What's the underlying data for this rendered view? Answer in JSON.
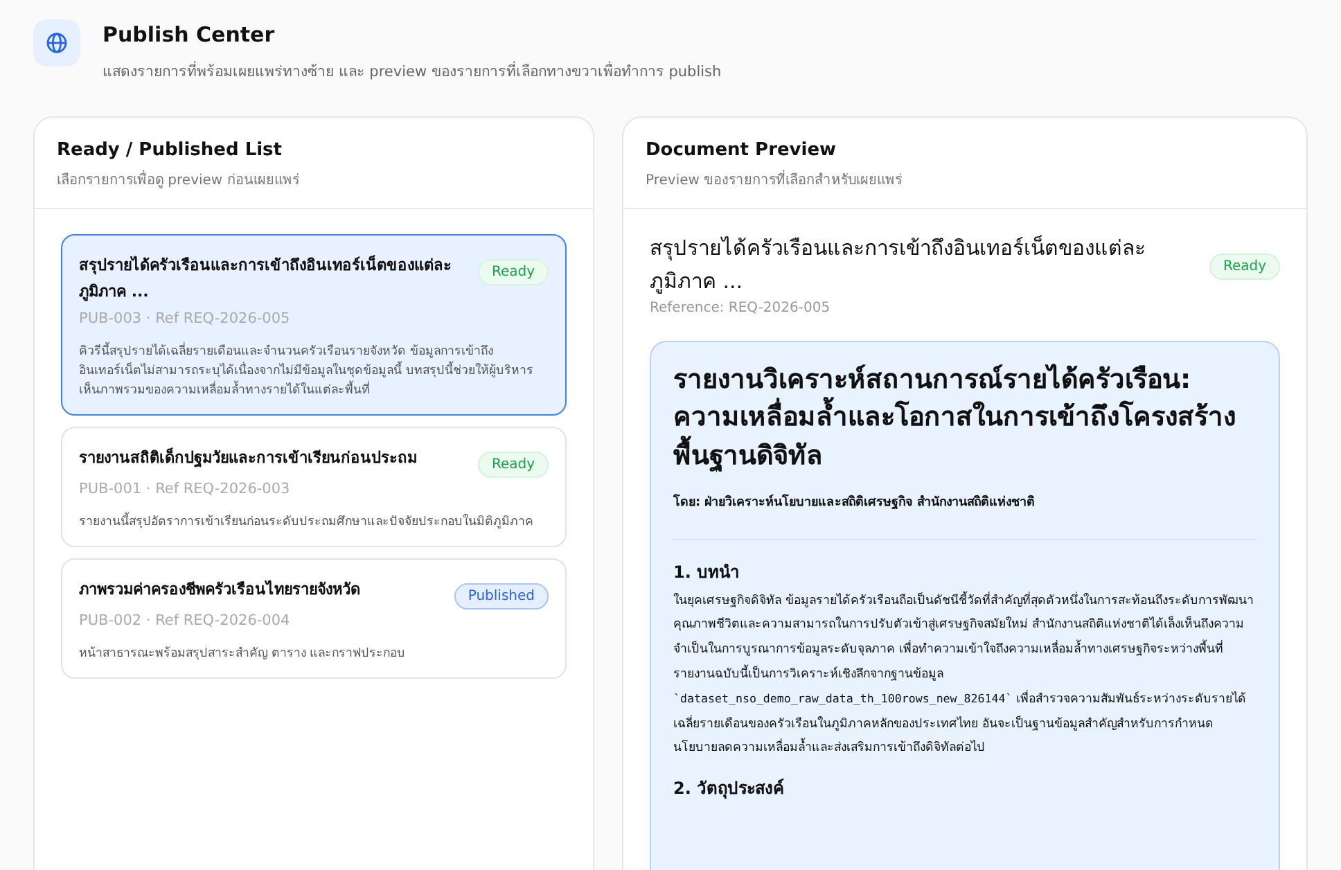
{
  "header": {
    "title": "Publish Center",
    "subtitle": "แสดงรายการที่พร้อมเผยแพร่ทางซ้าย และ preview ของรายการที่เลือกทางขวาเพื่อทำการ publish"
  },
  "list_panel": {
    "title": "Ready / Published List",
    "subtitle": "เลือกรายการเพื่อดู preview ก่อนเผยแพร่",
    "items": [
      {
        "title": "สรุปรายได้ครัวเรือนและการเข้าถึงอินเทอร์เน็ตของแต่ละภูมิภาค ...",
        "meta": "PUB-003 · Ref REQ-2026-005",
        "status": "Ready",
        "kind": "ready",
        "description": "คิวรีนี้สรุปรายได้เฉลี่ยรายเดือนและจำนวนครัวเรือนรายจังหวัด ข้อมูลการเข้าถึงอินเทอร์เน็ตไม่สามารถระบุได้เนื่องจากไม่มีข้อมูลในชุดข้อมูลนี้ บทสรุปนี้ช่วยให้ผู้บริหารเห็นภาพรวมของความเหลื่อมล้ำทางรายได้ในแต่ละพื้นที่",
        "selected": true
      },
      {
        "title": "รายงานสถิติเด็กปฐมวัยและการเข้าเรียนก่อนประถม",
        "meta": "PUB-001 · Ref REQ-2026-003",
        "status": "Ready",
        "kind": "ready",
        "description": "รายงานนี้สรุปอัตราการเข้าเรียนก่อนระดับประถมศึกษาและปัจจัยประกอบในมิติภูมิภาค",
        "selected": false
      },
      {
        "title": "ภาพรวมค่าครองชีพครัวเรือนไทยรายจังหวัด",
        "meta": "PUB-002 · Ref REQ-2026-004",
        "status": "Published",
        "kind": "published",
        "description": "หน้าสาธารณะพร้อมสรุปสาระสำคัญ ตาราง และกราฟประกอบ",
        "selected": false
      }
    ]
  },
  "preview_panel": {
    "title": "Document Preview",
    "subtitle": "Preview ของรายการที่เลือกสำหรับเผยแพร่",
    "doc_title": "สรุปรายได้ครัวเรือนและการเข้าถึงอินเทอร์เน็ตของแต่ละภูมิภาค ...",
    "status": "Ready",
    "kind": "ready",
    "reference": "Reference: REQ-2026-005",
    "document": {
      "heading": "รายงานวิเคราะห์สถานการณ์รายได้ครัวเรือน: ความเหลื่อมล้ำและโอกาสในการเข้าถึงโครงสร้างพื้นฐานดิจิทัล",
      "byline": "โดย: ฝ่ายวิเคราะห์นโยบายและสถิติเศรษฐกิจ สำนักงานสถิติแห่งชาติ",
      "sections": [
        {
          "heading": "1. บทนำ",
          "paragraph": [
            {
              "kind": "text",
              "text": "ในยุคเศรษฐกิจดิจิทัล ข้อมูลรายได้ครัวเรือนถือเป็นดัชนีชี้วัดที่สำคัญที่สุดตัวหนึ่งในการสะท้อนถึงระดับการพัฒนาคุณภาพชีวิตและความสามารถในการปรับตัวเข้าสู่เศรษฐกิจสมัยใหม่ สำนักงานสถิติแห่งชาติได้เล็งเห็นถึงความจำเป็นในการบูรณาการข้อมูลระดับจุลภาค เพื่อทำความเข้าใจถึงความเหลื่อมล้ำทางเศรษฐกิจระหว่างพื้นที่ รายงานฉบับนี้เป็นการวิเคราะห์เชิงลึกจากฐานข้อมูล "
            },
            {
              "kind": "code",
              "text": "`dataset_nso_demo_raw_data_th_100rows_new_826144`"
            },
            {
              "kind": "text",
              "text": " เพื่อสำรวจความสัมพันธ์ระหว่างระดับรายได้เฉลี่ยรายเดือนของครัวเรือนในภูมิภาคหลักของประเทศไทย อันจะเป็นฐานข้อมูลสำคัญสำหรับการกำหนดนโยบายลดความเหลื่อมล้ำและส่งเสริมการเข้าถึงดิจิทัลต่อไป"
            }
          ]
        },
        {
          "heading": "2. วัตถุประสงค์"
        }
      ]
    }
  }
}
